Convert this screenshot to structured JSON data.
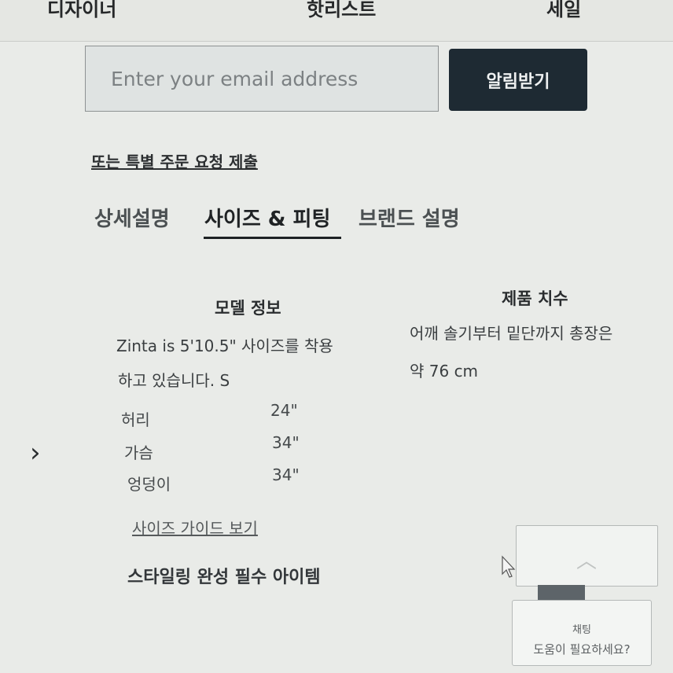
{
  "nav": {
    "items": [
      "디자이너",
      "핫리스트",
      "세일"
    ]
  },
  "newsletter": {
    "placeholder": "Enter your email address",
    "button_label": "알림받기"
  },
  "special_order_link": "또는 특별 주문 요청 제출",
  "tabs": [
    {
      "label": "상세설명",
      "active": false
    },
    {
      "label": "사이즈 & 피팅",
      "active": true
    },
    {
      "label": "브랜드 설명",
      "active": false
    }
  ],
  "model_info": {
    "title": "모델 정보",
    "line1": "Zinta is 5'10.5\" 사이즈를 착용",
    "line2": "하고 있습니다. S",
    "measurements": [
      {
        "label": "허리",
        "value": "24\""
      },
      {
        "label": "가슴",
        "value": "34\""
      },
      {
        "label": "엉덩이",
        "value": "34\""
      }
    ]
  },
  "product_dimensions": {
    "title": "제품 치수",
    "line1": "어깨 솔기부터 밑단까지 총장은",
    "line2": "약 76 cm"
  },
  "size_guide_link": "사이즈 가이드 보기",
  "must_have_heading": "스타일링 완성 필수 아이템",
  "chat": {
    "title": "채팅",
    "message": "도움이 필요하세요?"
  },
  "icons": {
    "chevron": "chevron-right-icon",
    "scroll_top": "chevron-up-icon",
    "cursor": "mouse-cursor-icon"
  }
}
